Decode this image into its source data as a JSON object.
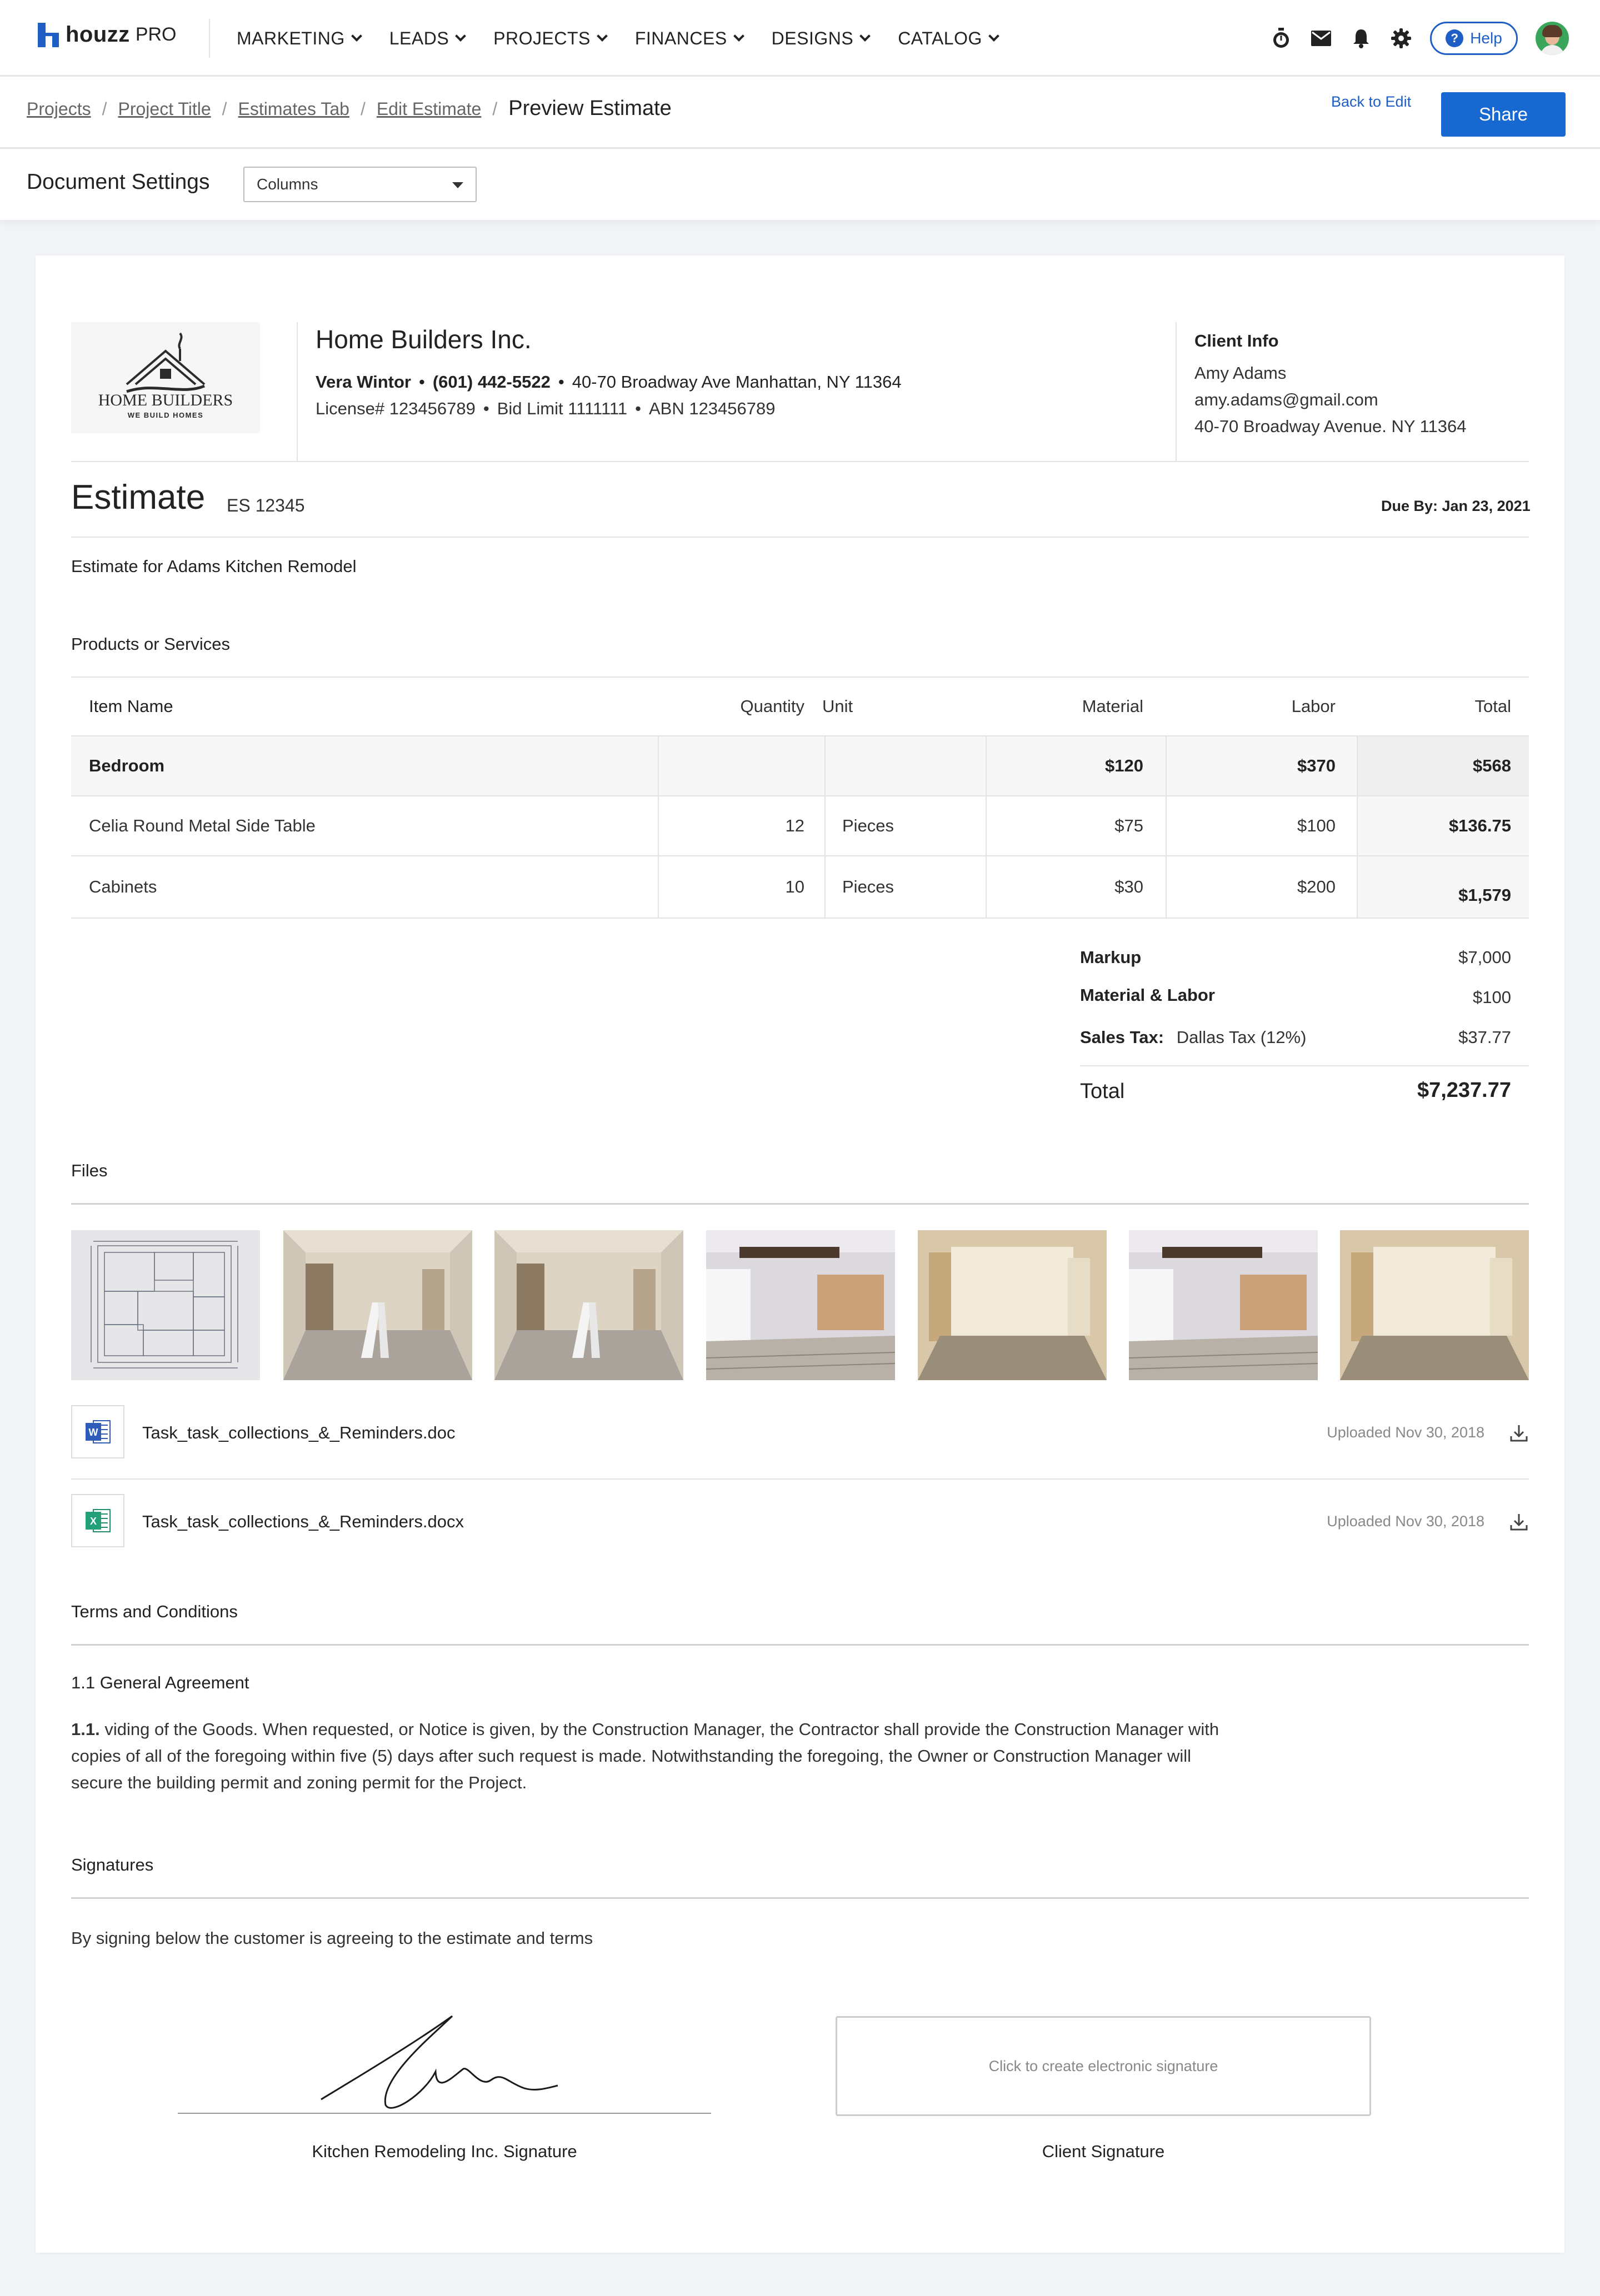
{
  "nav": {
    "brand": "houzz",
    "brand_suffix": "PRO",
    "menu": [
      "MARKETING",
      "LEADS",
      "PROJECTS",
      "FINANCES",
      "DESIGNS",
      "CATALOG"
    ],
    "icons": [
      "timer-icon",
      "mail-icon",
      "bell-icon",
      "gear-icon"
    ],
    "help_label": "Help"
  },
  "breadcrumb": {
    "items": [
      "Projects",
      "Project Title",
      "Estimates Tab",
      "Edit Estimate"
    ],
    "current": "Preview Estimate",
    "back_label": "Back to Edit",
    "share_label": "Share"
  },
  "settings": {
    "title": "Document Settings",
    "columns_value": "Columns"
  },
  "company": {
    "logo_title": "HOME BUILDERS",
    "logo_tagline": "WE BUILD HOMES",
    "name": "Home Builders Inc.",
    "contact_name": "Vera Wintor",
    "phone": "(601) 442-5522",
    "address": "40-70 Broadway Ave Manhattan, NY 11364",
    "license": "License# 123456789",
    "bid_limit": "Bid Limit 1111111",
    "abn": "ABN 123456789"
  },
  "client": {
    "title": "Client Info",
    "name": "Amy Adams",
    "email": "amy.adams@gmail.com",
    "address": "40-70 Broadway Avenue. NY 11364"
  },
  "estimate": {
    "title": "Estimate",
    "number": "ES 12345",
    "due": "Due By: Jan 23, 2021",
    "description": "Estimate for Adams Kitchen Remodel"
  },
  "products": {
    "section_title": "Products or Services",
    "headers": [
      "Item Name",
      "Quantity",
      "Unit",
      "Material",
      "Labor",
      "Total"
    ],
    "group": {
      "name": "Bedroom",
      "material": "$120",
      "labor": "$370",
      "total": "$568"
    },
    "rows": [
      {
        "name": "Celia Round Metal Side Table",
        "quantity": "12",
        "unit": "Pieces",
        "material": "$75",
        "labor": "$100",
        "total": "$136.75"
      },
      {
        "name": "Cabinets",
        "quantity": "10",
        "unit": "Pieces",
        "material": "$30",
        "labor": "$200",
        "total": "$1,579"
      }
    ]
  },
  "summary": {
    "markup_label": "Markup",
    "markup": "$7,000",
    "ml_label": "Material & Labor",
    "ml": "$100",
    "tax_label": "Sales Tax:",
    "tax_name": "Dallas Tax (12%)",
    "tax": "$37.77",
    "total_label": "Total",
    "total": "$7,237.77"
  },
  "files": {
    "section_title": "Files",
    "thumbnails": [
      "blueprint",
      "room-ladder",
      "room-ladder",
      "room-white",
      "room-bright",
      "room-white",
      "room-bright"
    ],
    "documents": [
      {
        "name": "Task_task_collections_&_Reminders.doc",
        "date": "Uploaded Nov 30, 2018",
        "type": "word"
      },
      {
        "name": "Task_task_collections_&_Reminders.docx",
        "date": "Uploaded Nov 30, 2018",
        "type": "excel"
      }
    ]
  },
  "terms": {
    "section_title": "Terms and Conditions",
    "subtitle": "1.1 General Agreement",
    "clause_num": "1.1.",
    "clause_text": "viding of the Goods. When requested, or Notice is given, by the Construction Manager, the Contractor shall provide the Construction Manager with copies of all of the foregoing within five (5) days after such request is made. Notwithstanding the foregoing, the Owner or Construction Manager will secure the building permit and zoning permit for the Project."
  },
  "signatures": {
    "section_title": "Signatures",
    "note": "By signing below the customer is agreeing to the estimate and terms",
    "contractor_label": "Kitchen Remodeling Inc. Signature",
    "client_label": "Client Signature",
    "client_placeholder": "Click to create electronic signature"
  },
  "colors": {
    "brand_blue": "#1f5ec5",
    "share_blue": "#1769d1",
    "page_bg": "#f2f5f8"
  }
}
